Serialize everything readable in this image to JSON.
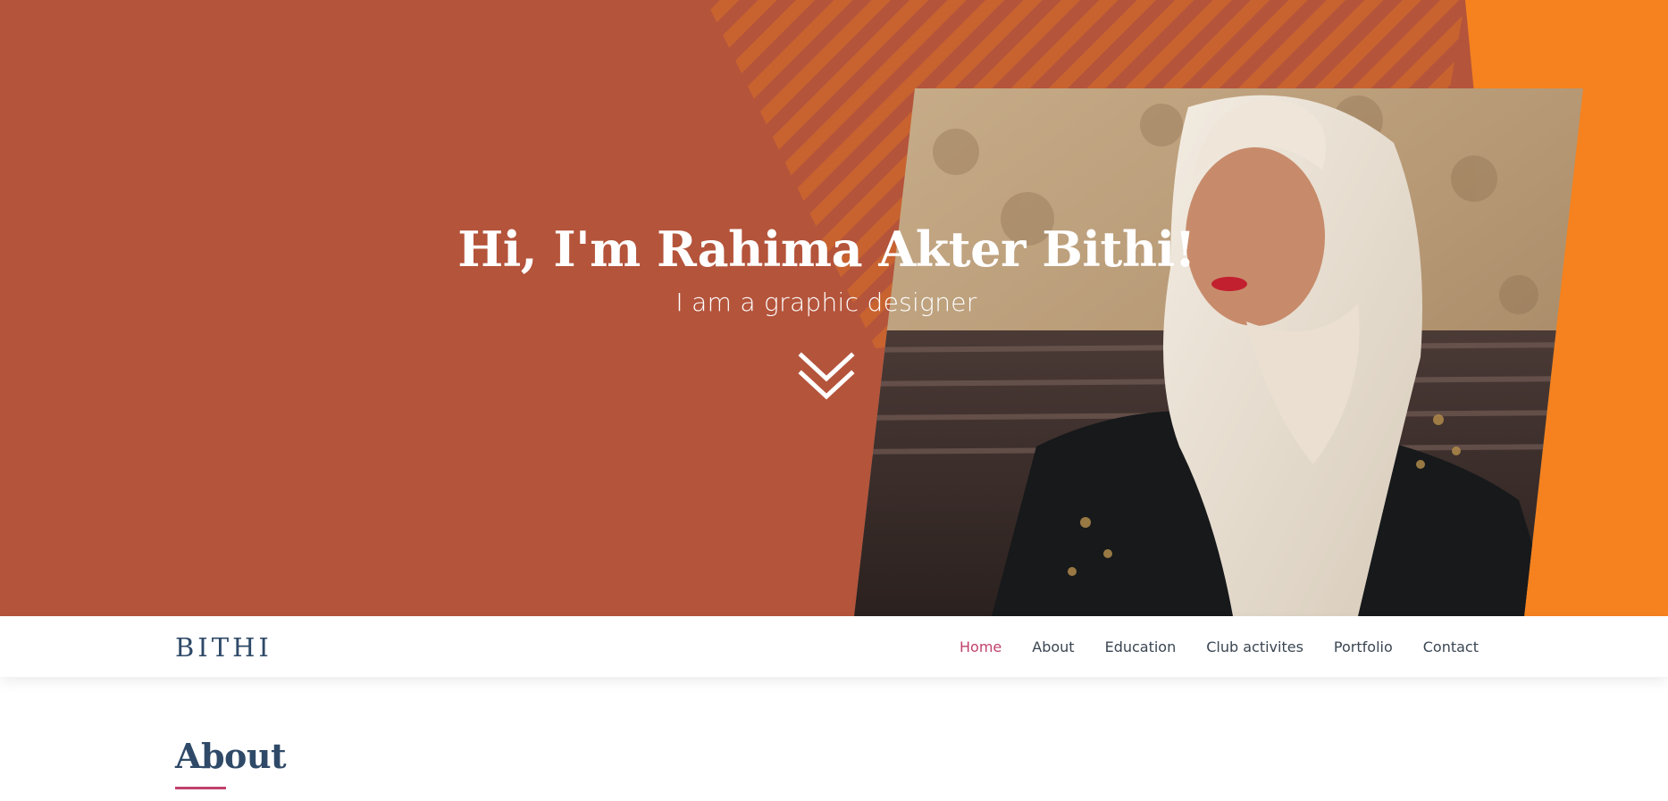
{
  "hero": {
    "heading": "Hi, I'm Rahima Akter Bithi!",
    "subheading": "I am a graphic designer",
    "scroll_icon": "double-chevron-down-icon",
    "photo_description_alt": "Portrait photo",
    "colors": {
      "background": "#b4543b",
      "accent_orange": "#f5821f",
      "stripes": "#c9642f"
    }
  },
  "navbar": {
    "brand": "BITHI",
    "links": [
      {
        "label": "Home",
        "active": true
      },
      {
        "label": "About",
        "active": false
      },
      {
        "label": "Education",
        "active": false
      },
      {
        "label": "Club activites",
        "active": false
      },
      {
        "label": "Portfolio",
        "active": false
      },
      {
        "label": "Contact",
        "active": false
      }
    ],
    "colors": {
      "brand": "#2f4a68",
      "link": "#3a4652",
      "active": "#c0426b"
    }
  },
  "about": {
    "title": "About"
  }
}
